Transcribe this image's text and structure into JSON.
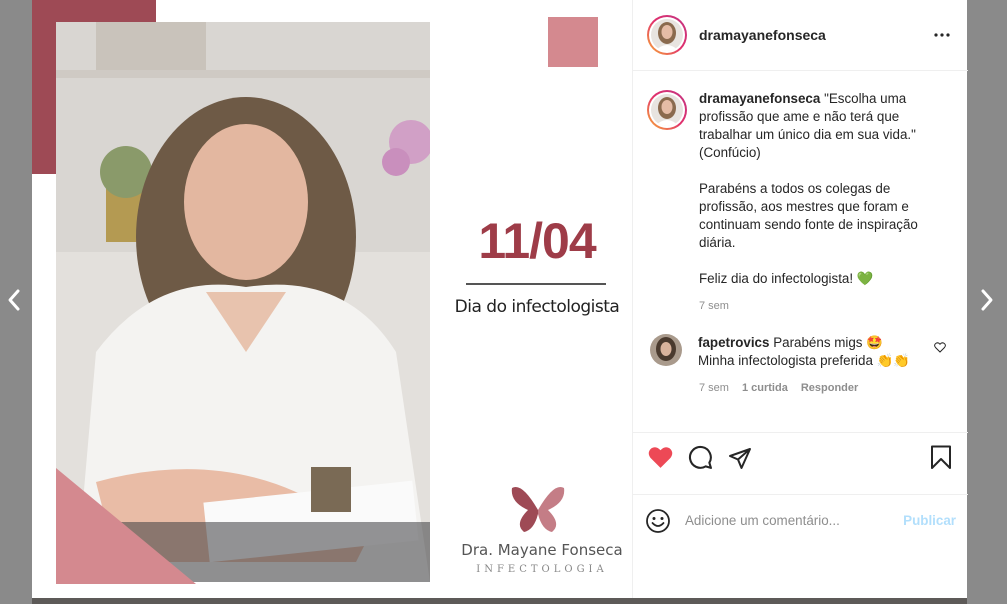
{
  "post": {
    "date": "11/04",
    "headline": "Dia do infectologista",
    "brand_name": "Dra. Mayane Fonseca",
    "brand_specialty": "INFECTOLOGIA"
  },
  "header": {
    "username": "dramayanefonseca"
  },
  "caption": {
    "username": "dramayanefonseca",
    "text": "\"Escolha uma profissão que ame e não terá que trabalhar um único dia em sua vida.\" (Confúcio)\n\nParabéns a todos os colegas de profissão, aos mestres que foram e continuam sendo fonte de inspiração diária.\n\nFeliz dia do infectologista! 💚",
    "time": "7 sem"
  },
  "comment": {
    "username": "fapetrovics",
    "text": "Parabéns migs 🤩 Minha infectologista preferida 👏👏",
    "time": "7 sem",
    "likes": "1 curtida",
    "reply_label": "Responder"
  },
  "add_comment": {
    "placeholder": "Adicione um comentário...",
    "publish_label": "Publicar"
  },
  "colors": {
    "accent_pink": "#d4898f",
    "accent_maroon": "#9e4a55",
    "like_red": "#ed4956",
    "publish_disabled": "#b2dffc"
  },
  "icons": [
    "chevron-left-icon",
    "chevron-right-icon",
    "more-horizontal-icon",
    "heart-icon",
    "comment-icon",
    "share-icon",
    "bookmark-icon",
    "emoji-icon"
  ]
}
